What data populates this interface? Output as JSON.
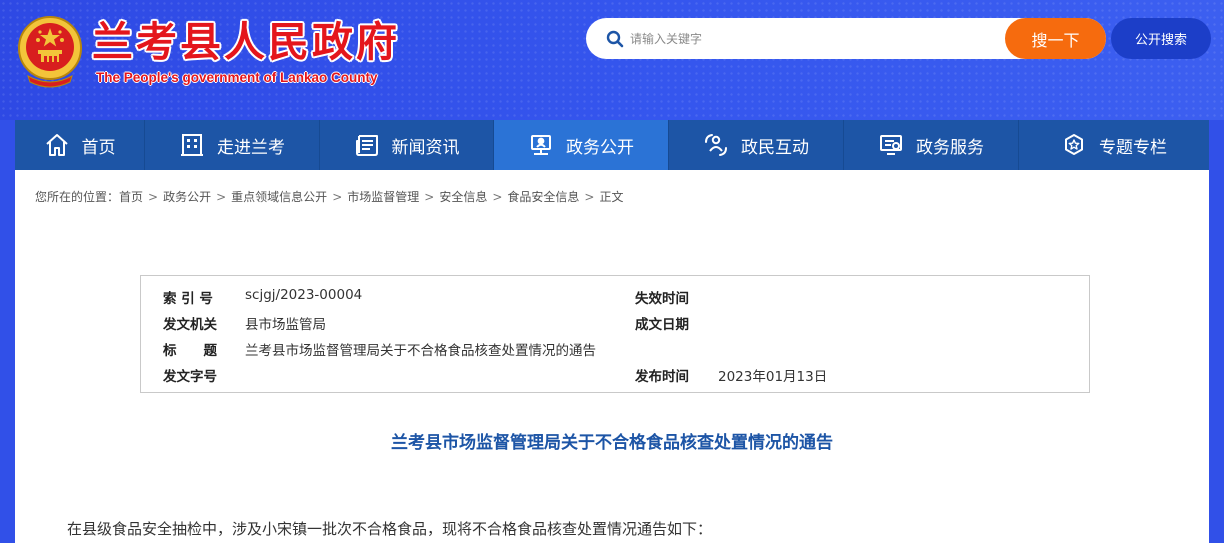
{
  "header": {
    "title": "兰考县人民政府",
    "subtitle": "The People's government of Lankao County"
  },
  "search": {
    "placeholder": "请输入关键字",
    "value": "",
    "button_label": "搜一下",
    "public_button_label": "公开搜索"
  },
  "nav": {
    "items": [
      {
        "label": "首页",
        "icon": "home-icon"
      },
      {
        "label": "走进兰考",
        "icon": "building-icon"
      },
      {
        "label": "新闻资讯",
        "icon": "newspaper-icon"
      },
      {
        "label": "政务公开",
        "icon": "government-affairs-icon",
        "active": true
      },
      {
        "label": "政民互动",
        "icon": "interaction-icon"
      },
      {
        "label": "政务服务",
        "icon": "service-icon"
      },
      {
        "label": "专题专栏",
        "icon": "special-topic-icon"
      }
    ]
  },
  "breadcrumb": {
    "prefix": "您所在的位置：",
    "items": [
      "首页",
      "政务公开",
      "重点领域信息公开",
      "市场监督管理",
      "安全信息",
      "食品安全信息",
      "正文"
    ],
    "separator": ">"
  },
  "meta": {
    "index_label": "索 引 号",
    "index_value": "scjgj/2023-00004",
    "expire_label": "失效时间",
    "expire_value": "",
    "issuer_label": "发文机关",
    "issuer_value": "县市场监管局",
    "created_label": "成文日期",
    "created_value": "",
    "subject_label": "标　　题",
    "subject_value": "兰考县市场监督管理局关于不合格食品核查处置情况的通告",
    "docno_label": "发文字号",
    "docno_value": "",
    "publish_label": "发布时间",
    "publish_value": "2023年01月13日"
  },
  "article": {
    "title": "兰考县市场监督管理局关于不合格食品核查处置情况的通告",
    "paragraph_1": "在县级食品安全抽检中，涉及小宋镇一批次不合格食品，现将不合格食品核查处置情况通告如下："
  },
  "colors": {
    "header_bg": "#3150e8",
    "nav_bg": "#1d55a6",
    "nav_active": "#2b73d6",
    "search_button": "#f66b0e",
    "public_search_button": "#1c3ec8",
    "title_red": "#e4161c",
    "article_title": "#1d55a6"
  }
}
